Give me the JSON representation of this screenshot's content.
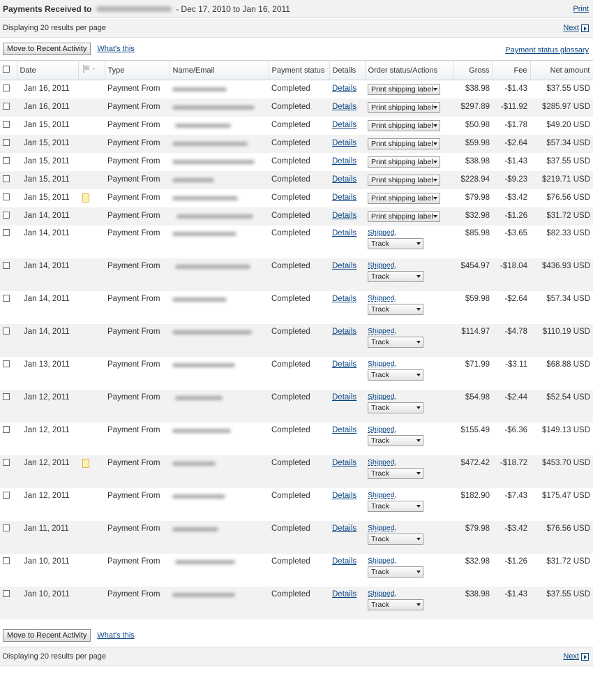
{
  "header": {
    "title_prefix": "Payments Received to",
    "date_range": "- Dec 17, 2010 to Jan 16, 2011",
    "print_link": "Print"
  },
  "top_pager": {
    "results_text": "Displaying 20 results per page",
    "next_link": "Next"
  },
  "top_actions": {
    "move_button": "Move to Recent Activity",
    "whats_this": "What's this",
    "glossary_link": "Payment status glossary"
  },
  "table": {
    "columns": {
      "date": "Date",
      "type": "Type",
      "name_email": "Name/Email",
      "payment_status": "Payment status",
      "details": "Details",
      "order_status": "Order status/Actions",
      "gross": "Gross",
      "fee": "Fee",
      "net": "Net amount"
    },
    "rows": [
      {
        "date": "Jan 16, 2011",
        "type": "Payment From",
        "status": "Completed",
        "details": "Details",
        "action": "Print shipping label",
        "shipped": "",
        "gross": "$38.98",
        "fee": "-$1.43",
        "net": "$37.55 USD",
        "note": false
      },
      {
        "date": "Jan 16, 2011",
        "type": "Payment From",
        "status": "Completed",
        "details": "Details",
        "action": "Print shipping label",
        "shipped": "",
        "gross": "$297.89",
        "fee": "-$11.92",
        "net": "$285.97 USD",
        "note": false
      },
      {
        "date": "Jan 15, 2011",
        "type": "Payment From",
        "status": "Completed",
        "details": "Details",
        "action": "Print shipping label",
        "shipped": "",
        "gross": "$50.98",
        "fee": "-$1.78",
        "net": "$49.20 USD",
        "note": false
      },
      {
        "date": "Jan 15, 2011",
        "type": "Payment From",
        "status": "Completed",
        "details": "Details",
        "action": "Print shipping label",
        "shipped": "",
        "gross": "$59.98",
        "fee": "-$2.64",
        "net": "$57.34 USD",
        "note": false
      },
      {
        "date": "Jan 15, 2011",
        "type": "Payment From",
        "status": "Completed",
        "details": "Details",
        "action": "Print shipping label",
        "shipped": "",
        "gross": "$38.98",
        "fee": "-$1.43",
        "net": "$37.55 USD",
        "note": false
      },
      {
        "date": "Jan 15, 2011",
        "type": "Payment From",
        "status": "Completed",
        "details": "Details",
        "action": "Print shipping label",
        "shipped": "",
        "gross": "$228.94",
        "fee": "-$9.23",
        "net": "$219.71 USD",
        "note": false
      },
      {
        "date": "Jan 15, 2011",
        "type": "Payment From",
        "status": "Completed",
        "details": "Details",
        "action": "Print shipping label",
        "shipped": "",
        "gross": "$79.98",
        "fee": "-$3.42",
        "net": "$76.56 USD",
        "note": true
      },
      {
        "date": "Jan 14, 2011",
        "type": "Payment From",
        "status": "Completed",
        "details": "Details",
        "action": "Print shipping label",
        "shipped": "",
        "gross": "$32.98",
        "fee": "-$1.26",
        "net": "$31.72 USD",
        "note": false
      },
      {
        "date": "Jan 14, 2011",
        "type": "Payment From",
        "status": "Completed",
        "details": "Details",
        "action": "Track",
        "shipped": "Shipped,",
        "gross": "$85.98",
        "fee": "-$3.65",
        "net": "$82.33 USD",
        "note": false
      },
      {
        "date": "Jan 14, 2011",
        "type": "Payment From",
        "status": "Completed",
        "details": "Details",
        "action": "Track",
        "shipped": "Shipped,",
        "gross": "$454.97",
        "fee": "-$18.04",
        "net": "$436.93 USD",
        "note": false
      },
      {
        "date": "Jan 14, 2011",
        "type": "Payment From",
        "status": "Completed",
        "details": "Details",
        "action": "Track",
        "shipped": "Shipped,",
        "gross": "$59.98",
        "fee": "-$2.64",
        "net": "$57.34 USD",
        "note": false
      },
      {
        "date": "Jan 14, 2011",
        "type": "Payment From",
        "status": "Completed",
        "details": "Details",
        "action": "Track",
        "shipped": "Shipped,",
        "gross": "$114.97",
        "fee": "-$4.78",
        "net": "$110.19 USD",
        "note": false
      },
      {
        "date": "Jan 13, 2011",
        "type": "Payment From",
        "status": "Completed",
        "details": "Details",
        "action": "Track",
        "shipped": "Shipped,",
        "gross": "$71.99",
        "fee": "-$3.11",
        "net": "$68.88 USD",
        "note": false
      },
      {
        "date": "Jan 12, 2011",
        "type": "Payment From",
        "status": "Completed",
        "details": "Details",
        "action": "Track",
        "shipped": "Shipped,",
        "gross": "$54.98",
        "fee": "-$2.44",
        "net": "$52.54 USD",
        "note": false
      },
      {
        "date": "Jan 12, 2011",
        "type": "Payment From",
        "status": "Completed",
        "details": "Details",
        "action": "Track",
        "shipped": "Shipped,",
        "gross": "$155.49",
        "fee": "-$6.36",
        "net": "$149.13 USD",
        "note": false
      },
      {
        "date": "Jan 12, 2011",
        "type": "Payment From",
        "status": "Completed",
        "details": "Details",
        "action": "Track",
        "shipped": "Shipped,",
        "gross": "$472.42",
        "fee": "-$18.72",
        "net": "$453.70 USD",
        "note": true
      },
      {
        "date": "Jan 12, 2011",
        "type": "Payment From",
        "status": "Completed",
        "details": "Details",
        "action": "Track",
        "shipped": "Shipped,",
        "gross": "$182.90",
        "fee": "-$7.43",
        "net": "$175.47 USD",
        "note": false
      },
      {
        "date": "Jan 11, 2011",
        "type": "Payment From",
        "status": "Completed",
        "details": "Details",
        "action": "Track",
        "shipped": "Shipped,",
        "gross": "$79.98",
        "fee": "-$3.42",
        "net": "$76.56 USD",
        "note": false
      },
      {
        "date": "Jan 10, 2011",
        "type": "Payment From",
        "status": "Completed",
        "details": "Details",
        "action": "Track",
        "shipped": "Shipped,",
        "gross": "$32.98",
        "fee": "-$1.26",
        "net": "$31.72 USD",
        "note": false
      },
      {
        "date": "Jan 10, 2011",
        "type": "Payment From",
        "status": "Completed",
        "details": "Details",
        "action": "Track",
        "shipped": "Shipped,",
        "gross": "$38.98",
        "fee": "-$1.43",
        "net": "$37.55 USD",
        "note": false
      }
    ]
  },
  "bottom_actions": {
    "move_button": "Move to Recent Activity",
    "whats_this": "What's this"
  },
  "bottom_pager": {
    "results_text": "Displaying 20 results per page",
    "next_link": "Next"
  },
  "icons": {
    "flag_column": "flag-icon",
    "note": "note-icon",
    "next": "next-arrow-icon",
    "dropdown": "chevron-down-icon"
  },
  "colors": {
    "link": "#084482",
    "header_bg": "#f2f2f2",
    "alt_row": "#f2f2f2"
  }
}
